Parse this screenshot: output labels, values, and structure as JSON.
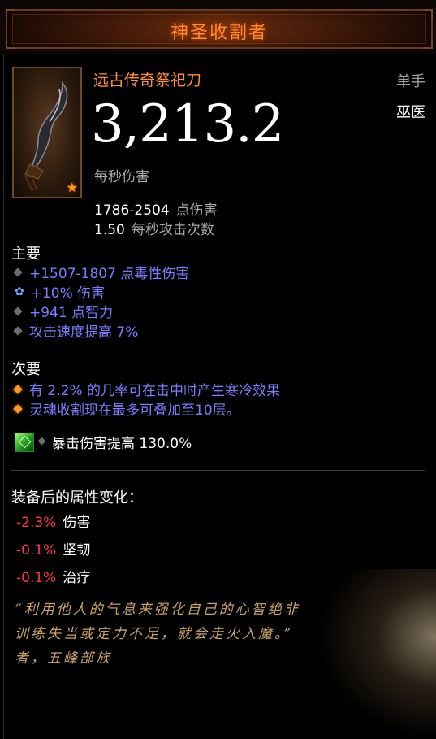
{
  "header": {
    "title": "神圣收割者"
  },
  "item": {
    "type": "远古传奇祭祀刀",
    "slot": "单手",
    "class": "巫医",
    "dps": "3,213.2",
    "dps_label": "每秒伤害",
    "damage_range": "1786-2504",
    "damage_label": "点伤害",
    "attack_speed": "1.50",
    "attack_speed_label": "每秒攻击次数",
    "icon": "ritual-dagger-icon",
    "rarity_icon": "star-icon"
  },
  "primary": {
    "title": "主要",
    "affixes": [
      {
        "text": "+1507-1807 点毒性伤害",
        "bullet": "grey-diamond"
      },
      {
        "text": "+10% 伤害",
        "bullet": "blue-swirl"
      },
      {
        "text": "+941 点智力",
        "bullet": "grey-diamond"
      },
      {
        "text": "攻击速度提高 7%",
        "bullet": "grey-diamond"
      }
    ]
  },
  "secondary": {
    "title": "次要",
    "affixes": [
      {
        "text": "有 2.2% 的几率可在击中时产生寒冷效果",
        "bullet": "orange-diamond"
      },
      {
        "text": "灵魂收割现在最多可叠加至10层。",
        "bullet": "orange-diamond"
      }
    ]
  },
  "gem": {
    "text": "暴击伤害提高 130.0%",
    "icon": "emerald-gem-icon"
  },
  "equip_changes": {
    "title": "装备后的属性变化：",
    "rows": [
      {
        "delta": "-2.3%",
        "name": "伤害"
      },
      {
        "delta": "-0.1%",
        "name": "坚韧"
      },
      {
        "delta": "-0.1%",
        "name": "治疗"
      }
    ]
  },
  "flavor": "“利用他人的气息来强化自己的心智绝非\n训练失当或定力不足，就会走火入魔。”\n者，五峰部族",
  "colors": {
    "title": "#ff8a30",
    "legendary": "#ff9132",
    "magic": "#7d7cff",
    "negative": "#ff3a3a",
    "flavor": "#c8a46a"
  }
}
